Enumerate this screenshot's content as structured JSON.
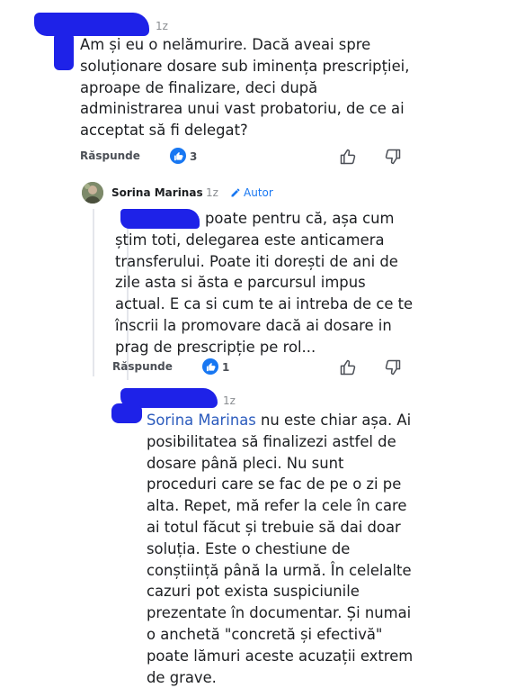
{
  "comments": [
    {
      "time": "1z",
      "text": "Am și eu o nelămurire. Dacă aveai spre\nsoluționare dosare sub iminența prescripției,\naproape de finalizare, deci după\nadministrarea unui vast probatoriu, de ce ai\nacceptat să fi delegat?",
      "reply_label": "Răspunde",
      "likes": "3"
    },
    {
      "author": "Sorina Marinas",
      "separator": "·",
      "time": "1z",
      "badge": "Autor",
      "text": "poate pentru că, așa cum\nștim toti, delegarea este anticamera\ntransferului. Poate iti dorești de ani de\nzile asta si ăsta e parcursul impus\nactual. E ca si cum te ai intreba de ce te\nînscrii la promovare dacă ai dosare in\nprag de prescripție pe rol...",
      "reply_label": "Răspunde",
      "likes": "1"
    },
    {
      "time": "1z",
      "mention": "Sorina Marinas",
      "text_after_mention": " nu este chiar așa. Ai\nposibilitatea să finalizezi astfel de\ndosare până pleci. Nu sunt\nproceduri care se fac de pe o zi pe\nalta. Repet, mă refer la cele în care\nai totul făcut și trebuie să dai doar\nsoluția. Este o chestiune de\nconștiință până la urmă. În celelalte\ncazuri pot exista suspiciunile\nprezentate în documentar. Și numai\no anchetă \"concretă și efectivă\"\npoate lămuri aceste acuzații extrem\nde grave."
    }
  ],
  "colors": {
    "redaction": "#1e22e8",
    "like_blue": "#1877f2",
    "mention": "#2b5bbd"
  },
  "icons": [
    "like-badge-icon",
    "thumbs-up-icon",
    "thumbs-down-icon",
    "pencil-icon"
  ]
}
